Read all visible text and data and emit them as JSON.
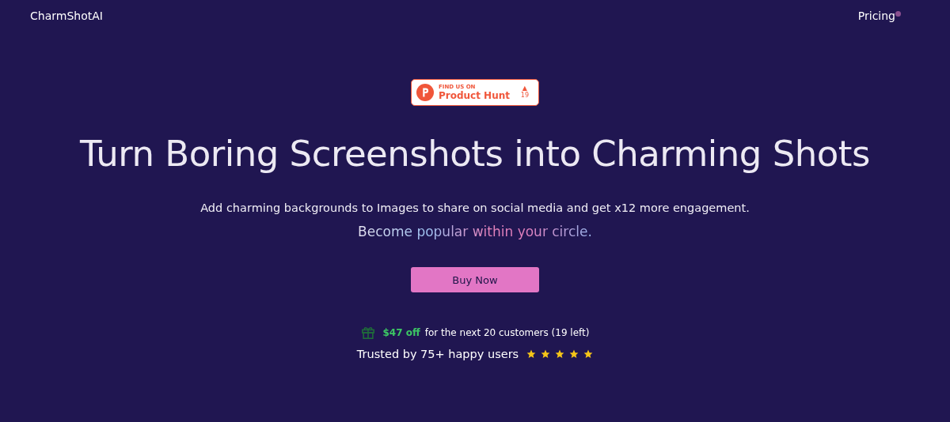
{
  "header": {
    "logo": "CharmShotAI",
    "nav": [
      {
        "label": "Pricing",
        "dot": true
      }
    ]
  },
  "badge": {
    "small": "FIND US ON",
    "name": "Product Hunt",
    "arrow": "▲",
    "votes": "19"
  },
  "headline": "Turn Boring Screenshots into Charming Shots",
  "subtitle": "Add charming backgrounds to Images to share on social media and get x12 more engagement.",
  "tagline": "Become popular within your circle.",
  "cta": {
    "label": "Buy Now"
  },
  "offer": {
    "amount": "$47 off",
    "text": "for the next 20 customers (19 left)"
  },
  "trust": {
    "text": "Trusted by 75+ happy users",
    "stars": 5
  }
}
